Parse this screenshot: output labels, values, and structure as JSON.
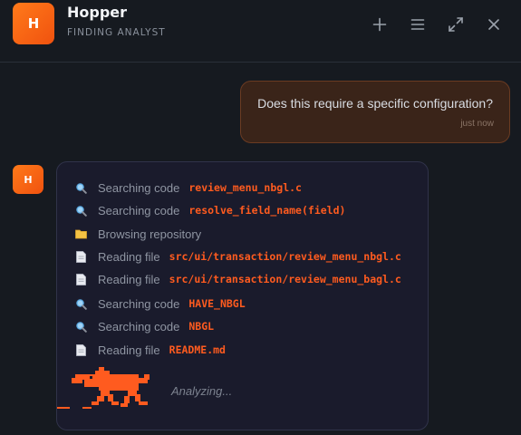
{
  "header": {
    "logo_letter": "H",
    "title": "Hopper",
    "subtitle": "FINDING ANALYST",
    "actions": [
      {
        "name": "add-button",
        "icon": "plus-icon"
      },
      {
        "name": "menu-button",
        "icon": "hamburger-icon"
      },
      {
        "name": "expand-button",
        "icon": "expand-icon"
      },
      {
        "name": "close-button",
        "icon": "close-icon"
      }
    ]
  },
  "user_message": {
    "text": "Does this require a specific configuration?",
    "time": "just now"
  },
  "assistant": {
    "avatar_letter": "H",
    "steps": [
      {
        "icon": "search-icon",
        "label": "Searching code",
        "arg": "review_menu_nbgl.c"
      },
      {
        "icon": "search-icon",
        "label": "Searching code",
        "arg": "resolve_field_name(field)"
      },
      {
        "icon": "folder-icon",
        "label": "Browsing repository",
        "arg": ""
      },
      {
        "icon": "file-icon",
        "label": "Reading file",
        "arg": "src/ui/transaction/review_menu_nbgl.c"
      },
      {
        "icon": "file-icon",
        "label": "Reading file",
        "arg": "src/ui/transaction/review_menu_bagl.c"
      },
      {
        "icon": "search-icon",
        "label": "Searching code",
        "arg": "HAVE_NBGL"
      },
      {
        "icon": "search-icon",
        "label": "Searching code",
        "arg": "NBGL"
      },
      {
        "icon": "file-icon",
        "label": "Reading file",
        "arg": "README.md"
      }
    ],
    "status": "Analyzing..."
  },
  "colors": {
    "accent": "#ff5b1f",
    "background": "#161a20",
    "card": "#1a1b2c",
    "user_bubble": "#3a2419"
  }
}
